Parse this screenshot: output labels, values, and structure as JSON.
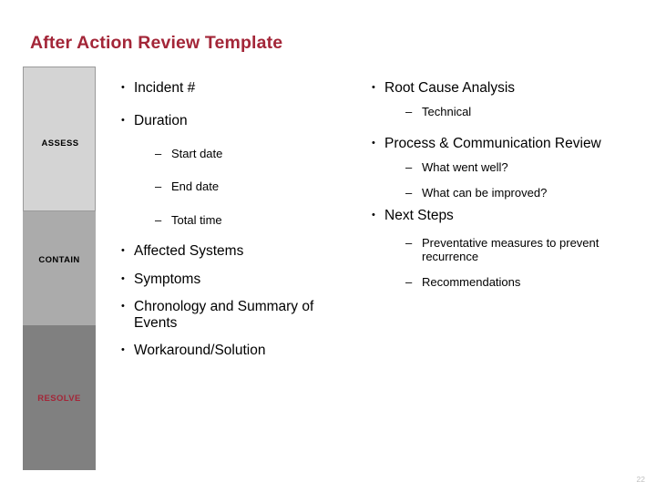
{
  "slide": {
    "title": "After Action Review Template",
    "title_color": "#A32638",
    "page_number": "22",
    "background_color": "#FFFFFF"
  },
  "phase_bar": {
    "blocks": [
      {
        "label": "ASSESS",
        "fill": "#D4D4D4",
        "text_color": "#000000"
      },
      {
        "label": "CONTAIN",
        "fill": "#ABABAB",
        "text_color": "#000000"
      },
      {
        "label": "RESOLVE",
        "fill": "#808080",
        "text_color": "#A32638"
      }
    ]
  },
  "content": {
    "left_column": {
      "items": [
        {
          "level": 1,
          "marker": "•",
          "text": "Incident #"
        },
        {
          "level": 1,
          "marker": "•",
          "text": "Duration"
        },
        {
          "level": 2,
          "marker": "–",
          "text": "Start date"
        },
        {
          "level": 2,
          "marker": "–",
          "text": "End date"
        },
        {
          "level": 2,
          "marker": "–",
          "text": "Total time"
        },
        {
          "level": 1,
          "marker": "•",
          "text": "Affected Systems"
        },
        {
          "level": 1,
          "marker": "•",
          "text": "Symptoms"
        },
        {
          "level": 1,
          "marker": "•",
          "text": "Chronology and Summary of Events"
        },
        {
          "level": 1,
          "marker": "•",
          "text": "Workaround/Solution"
        }
      ]
    },
    "right_column": {
      "items": [
        {
          "level": 1,
          "marker": "•",
          "text": "Root Cause Analysis"
        },
        {
          "level": 2,
          "marker": "–",
          "text": "Technical"
        },
        {
          "level": 1,
          "marker": "•",
          "text": "Process & Communication Review"
        },
        {
          "level": 2,
          "marker": "–",
          "text": "What went well?"
        },
        {
          "level": 2,
          "marker": "–",
          "text": "What can be improved?"
        },
        {
          "level": 1,
          "marker": "•",
          "text": "Next Steps"
        },
        {
          "level": 2,
          "marker": "–",
          "text": "Preventative measures to prevent recurrence"
        },
        {
          "level": 2,
          "marker": "–",
          "text": "Recommendations"
        }
      ]
    }
  }
}
